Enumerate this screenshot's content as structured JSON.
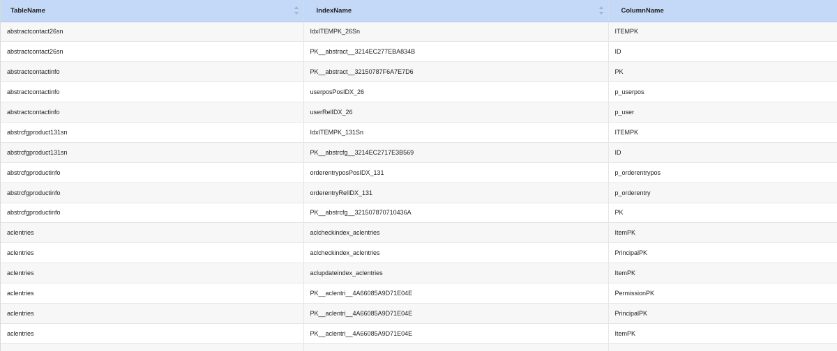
{
  "table": {
    "columns": [
      "TableName",
      "IndexName",
      "ColumnName"
    ],
    "rows": [
      [
        "abstractcontact26sn",
        "IdxITEMPK_26Sn",
        "ITEMPK"
      ],
      [
        "abstractcontact26sn",
        "PK__abstract__3214EC277EBA834B",
        "ID"
      ],
      [
        "abstractcontactinfo",
        "PK__abstract__32150787F6A7E7D6",
        "PK"
      ],
      [
        "abstractcontactinfo",
        "userposPosIDX_26",
        "p_userpos"
      ],
      [
        "abstractcontactinfo",
        "userRelIDX_26",
        "p_user"
      ],
      [
        "abstrcfgproduct131sn",
        "IdxITEMPK_131Sn",
        "ITEMPK"
      ],
      [
        "abstrcfgproduct131sn",
        "PK__abstrcfg__3214EC2717E3B569",
        "ID"
      ],
      [
        "abstrcfgproductinfo",
        "orderentryposPosIDX_131",
        "p_orderentrypos"
      ],
      [
        "abstrcfgproductinfo",
        "orderentryRelIDX_131",
        "p_orderentry"
      ],
      [
        "abstrcfgproductinfo",
        "PK__abstrcfg__321507870710436A",
        "PK"
      ],
      [
        "aclentries",
        "aclcheckindex_aclentries",
        "ItemPK"
      ],
      [
        "aclentries",
        "aclcheckindex_aclentries",
        "PrincipalPK"
      ],
      [
        "aclentries",
        "aclupdateindex_aclentries",
        "ItemPK"
      ],
      [
        "aclentries",
        "PK__aclentri__4A66085A9D71E04E",
        "PermissionPK"
      ],
      [
        "aclentries",
        "PK__aclentri__4A66085A9D71E04E",
        "PrincipalPK"
      ],
      [
        "aclentries",
        "PK__aclentri__4A66085A9D71E04E",
        "ItemPK"
      ],
      [
        "",
        "",
        ""
      ]
    ]
  }
}
